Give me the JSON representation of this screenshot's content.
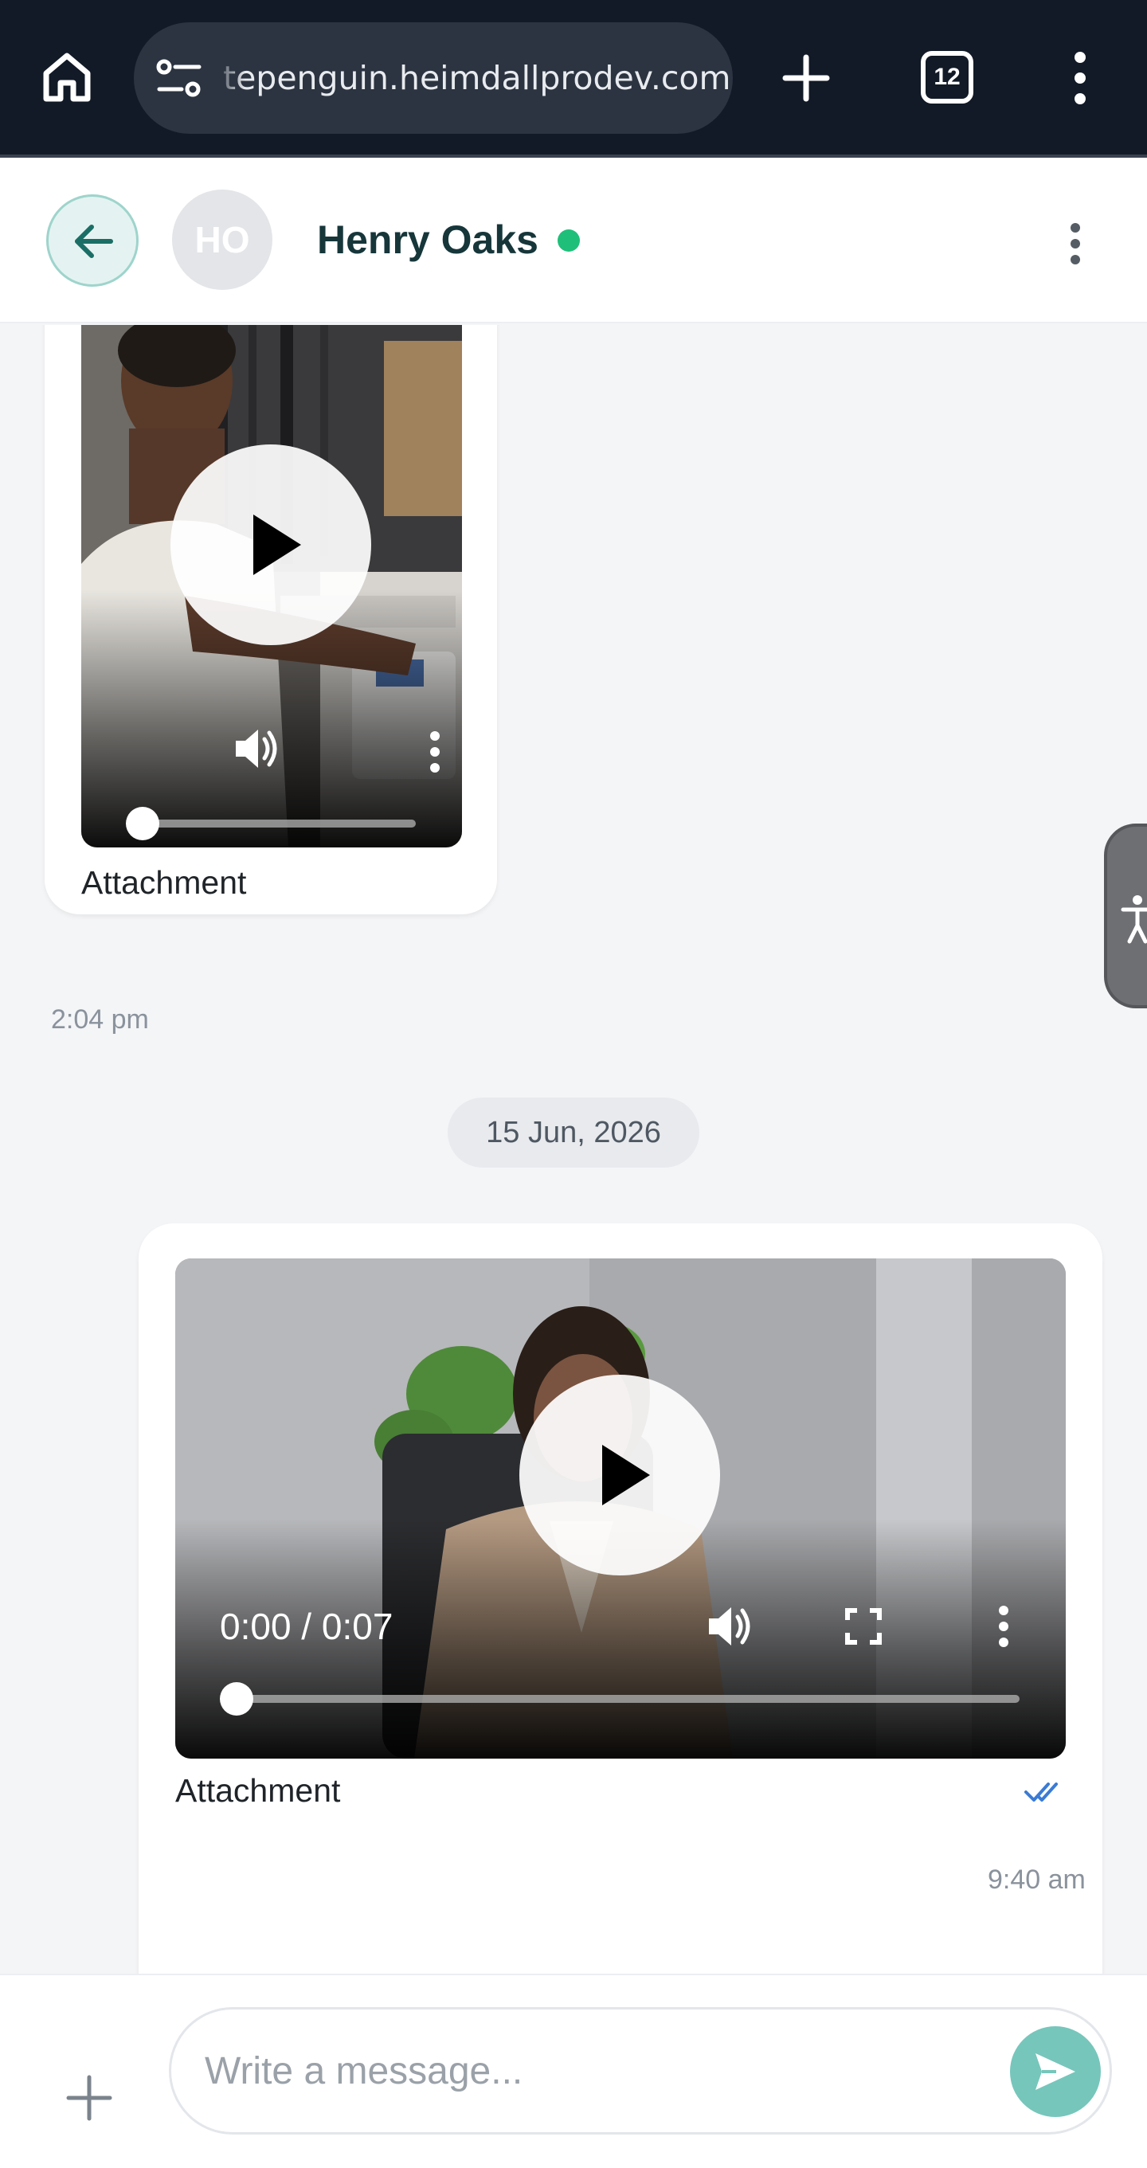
{
  "browser": {
    "url": "tepenguin.heimdallprodev.com",
    "tab_count": "12",
    "icons": [
      "home-icon",
      "site-settings-icon",
      "new-tab-icon",
      "tab-switcher",
      "browser-menu-icon"
    ]
  },
  "header": {
    "avatar_initials": "HO",
    "contact_name": "Henry Oaks",
    "status_color": "#1fbf7a"
  },
  "messages": {
    "incoming": {
      "caption": "Attachment",
      "time": "2:04 pm"
    },
    "date_divider": "15 Jun, 2026",
    "outgoing": {
      "video_time": "0:00 / 0:07",
      "caption": "Attachment",
      "time": "9:40 am",
      "read_status": "read"
    }
  },
  "composer": {
    "placeholder": "Write a message..."
  },
  "colors": {
    "accent": "#76c6bb",
    "browser_bar": "#121a27",
    "read_check": "#3a7bd5"
  }
}
